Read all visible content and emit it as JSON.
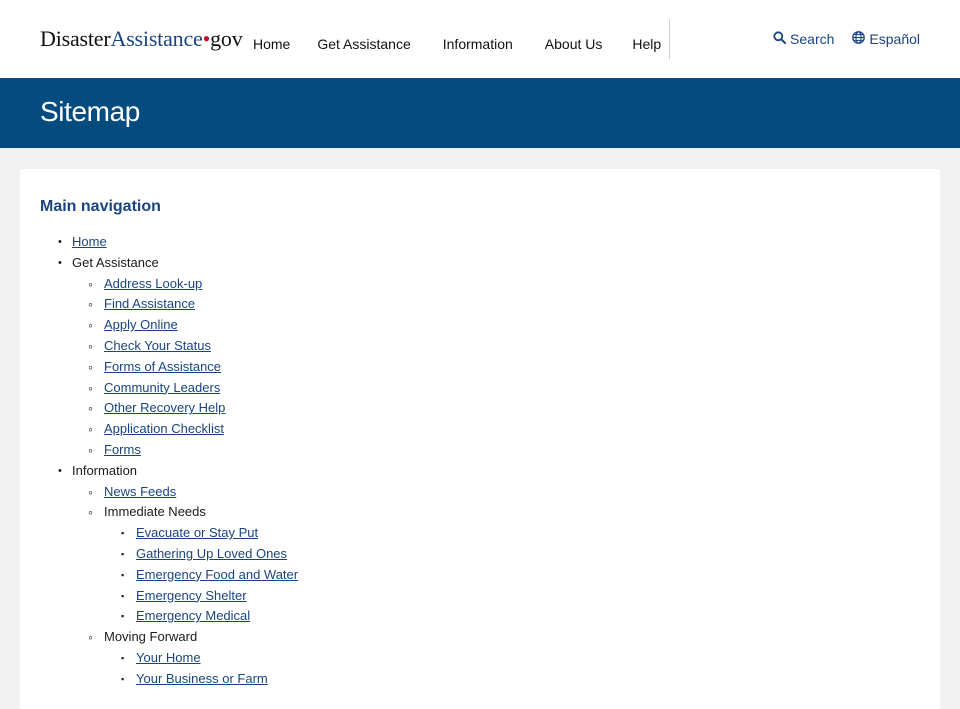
{
  "header": {
    "logo": {
      "part1": "Disaster",
      "part2": "Assistance",
      "dot": "•",
      "part3": "gov"
    },
    "nav": [
      "Home",
      "Get Assistance",
      "Information",
      "About Us",
      "Help"
    ],
    "search_label": "Search",
    "language_label": "Español"
  },
  "banner": {
    "title": "Sitemap"
  },
  "main": {
    "heading": "Main navigation",
    "home": "Home",
    "get_assistance": {
      "label": "Get Assistance",
      "links": [
        "Address Look-up",
        "Find Assistance",
        "Apply Online",
        "Check Your Status",
        "Forms of Assistance",
        "Community Leaders",
        "Other Recovery Help",
        "Application Checklist",
        "Forms"
      ]
    },
    "information": {
      "label": "Information",
      "news_feeds": "News Feeds",
      "immediate_needs": {
        "label": "Immediate Needs",
        "links": [
          "Evacuate or Stay Put",
          "Gathering Up Loved Ones",
          "Emergency Food and Water",
          "Emergency Shelter",
          "Emergency Medical"
        ]
      },
      "moving_forward": {
        "label": "Moving Forward",
        "links": [
          "Your Home",
          "Your Business or Farm"
        ]
      }
    }
  },
  "colors": {
    "banner": "#044c80",
    "link": "#1a4480",
    "logo_dot": "#c8102e",
    "page_bg": "#f1f1f1"
  },
  "icons": {
    "search": "search-icon",
    "language": "globe-icon"
  }
}
